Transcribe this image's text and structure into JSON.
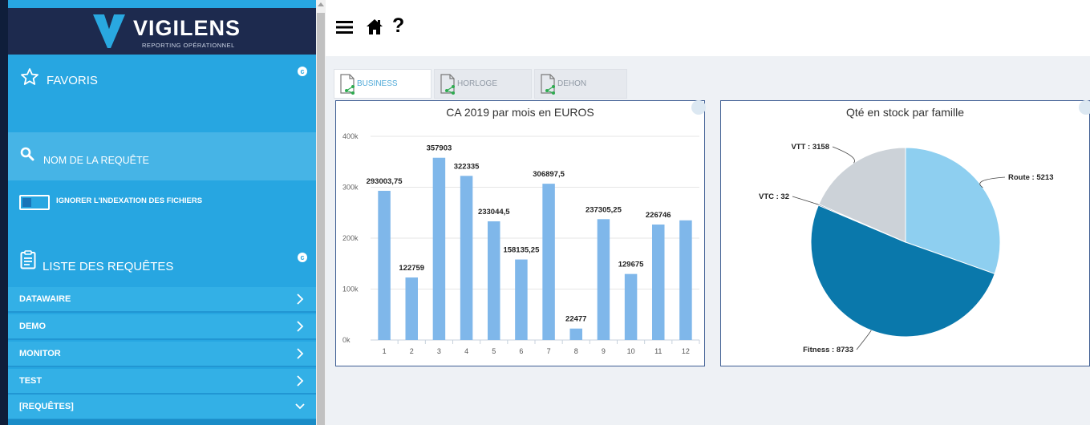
{
  "sidebar": {
    "brand": "VIGILENS",
    "brand_subtitle": "REPORTING OPÉRATIONNEL",
    "favoris_label": "FAVORIS",
    "search_label": "NOM DE LA REQUÊTE",
    "toggle_label": "IGNORER L'INDEXATION DES FICHIERS",
    "toggle_on": false,
    "list_label": "LISTE DES REQUÊTES",
    "items": [
      {
        "label": "DATAWAIRE",
        "icon": "chevron-right-icon"
      },
      {
        "label": "DEMO",
        "icon": "chevron-right-icon"
      },
      {
        "label": "MONITOR",
        "icon": "chevron-right-icon"
      },
      {
        "label": "TEST",
        "icon": "chevron-right-icon"
      },
      {
        "label": "[REQUÊTES]",
        "icon": "chevron-down-icon"
      }
    ]
  },
  "toolbar": {
    "menu_icon": "hamburger-icon",
    "home_icon": "home-icon",
    "help_label": "?"
  },
  "tabs": [
    {
      "label": "BUSINESS",
      "active": true
    },
    {
      "label": "HORLOGE",
      "active": false
    },
    {
      "label": "DEHON",
      "active": false
    }
  ],
  "colors": {
    "sidebar": "#27a6e1",
    "header": "#1d2a4e",
    "bar": "#7fb7ea",
    "pie_route": "#8ecff0",
    "pie_fitness": "#0a78ab",
    "pie_vtt": "#ccd2d8"
  },
  "chart_data": [
    {
      "type": "bar",
      "title": "CA 2019 par mois en EUROS",
      "categories": [
        "1",
        "2",
        "3",
        "4",
        "5",
        "6",
        "7",
        "8",
        "9",
        "10",
        "11",
        "12"
      ],
      "values": [
        293003.75,
        122759,
        357903,
        322335,
        233044.5,
        158135.25,
        306897.5,
        22477,
        237305.25,
        129675,
        226746,
        235000
      ],
      "data_labels": [
        "293003,75",
        "122759",
        "357903",
        "322335",
        "233044,5",
        "158135,25",
        "306897,5",
        "22477",
        "237305,25",
        "129675",
        "226746",
        ""
      ],
      "yticks": [
        "0k",
        "100k",
        "200k",
        "300k",
        "400k"
      ],
      "ylim": [
        0,
        400000
      ],
      "grid": true
    },
    {
      "type": "pie",
      "title": "Qté en stock par famille",
      "labels": [
        "Route",
        "Fitness",
        "VTC",
        "VTT"
      ],
      "values": [
        5213,
        8733,
        32,
        3158
      ],
      "display": [
        "Route : 5213",
        "Fitness : 8733",
        "VTC : 32",
        "VTT : 3158"
      ]
    }
  ]
}
